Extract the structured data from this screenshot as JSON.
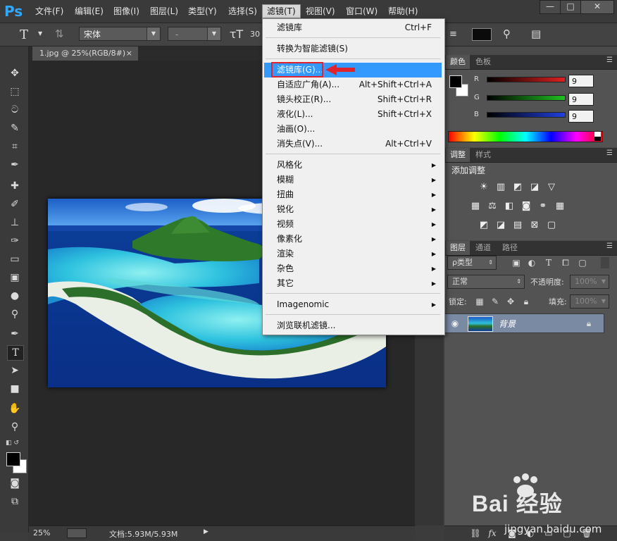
{
  "app": {
    "logo": "Ps"
  },
  "menubar": {
    "items": [
      "文件(F)",
      "编辑(E)",
      "图像(I)",
      "图层(L)",
      "类型(Y)",
      "选择(S)",
      "滤镜(T)",
      "视图(V)",
      "窗口(W)",
      "帮助(H)"
    ],
    "active_index": 6,
    "window_controls": [
      "—",
      "□",
      "✕"
    ]
  },
  "optionsbar": {
    "tool_glyph": "T",
    "font_family": "宋体",
    "font_style": "-",
    "font_size": "30"
  },
  "document": {
    "tab_title": "1.jpg @ 25%(RGB/8#)",
    "close": "×",
    "zoom": "25%",
    "doc_info": "文档:5.93M/5.93M"
  },
  "filter_menu": {
    "items": [
      {
        "label": "滤镜库",
        "shortcut": "Ctrl+F"
      },
      {
        "sep": true
      },
      {
        "label": "转换为智能滤镜(S)"
      },
      {
        "sep": true
      },
      {
        "label": "滤镜库(G)...",
        "highlighted": true
      },
      {
        "label": "自适应广角(A)...",
        "shortcut": "Alt+Shift+Ctrl+A"
      },
      {
        "label": "镜头校正(R)...",
        "shortcut": "Shift+Ctrl+R"
      },
      {
        "label": "液化(L)...",
        "shortcut": "Shift+Ctrl+X"
      },
      {
        "label": "油画(O)..."
      },
      {
        "label": "消失点(V)...",
        "shortcut": "Alt+Ctrl+V"
      },
      {
        "sep": true
      },
      {
        "label": "风格化",
        "submenu": true
      },
      {
        "label": "模糊",
        "submenu": true
      },
      {
        "label": "扭曲",
        "submenu": true
      },
      {
        "label": "锐化",
        "submenu": true
      },
      {
        "label": "视频",
        "submenu": true
      },
      {
        "label": "像素化",
        "submenu": true
      },
      {
        "label": "渲染",
        "submenu": true
      },
      {
        "label": "杂色",
        "submenu": true
      },
      {
        "label": "其它",
        "submenu": true
      },
      {
        "sep": true
      },
      {
        "label": "Imagenomic",
        "submenu": true
      },
      {
        "sep": true
      },
      {
        "label": "浏览联机滤镜..."
      }
    ]
  },
  "color_panel": {
    "tabs": [
      "颜色",
      "色板"
    ],
    "channels": [
      {
        "name": "R",
        "value": "9",
        "color": "#e02020"
      },
      {
        "name": "G",
        "value": "9",
        "color": "#20c020"
      },
      {
        "name": "B",
        "value": "9",
        "color": "#2040e0"
      }
    ]
  },
  "adjust_panel": {
    "tabs": [
      "调整",
      "样式"
    ],
    "title": "添加调整"
  },
  "layers_panel": {
    "tabs": [
      "图层",
      "通道",
      "路径"
    ],
    "filter_kind": "ρ类型",
    "blend_mode": "正常",
    "opacity_label": "不透明度:",
    "opacity_value": "100%",
    "lock_label": "锁定:",
    "fill_label": "填充:",
    "fill_value": "100%",
    "layers": [
      {
        "name": "背景",
        "locked": true
      }
    ]
  },
  "watermark": {
    "brand": "Bai 经验",
    "url": "jingyan.baidu.com"
  },
  "colors": {
    "menu_highlight": "#3399ff",
    "annotation_red": "#e0242e",
    "ps_blue": "#31a8ff"
  }
}
